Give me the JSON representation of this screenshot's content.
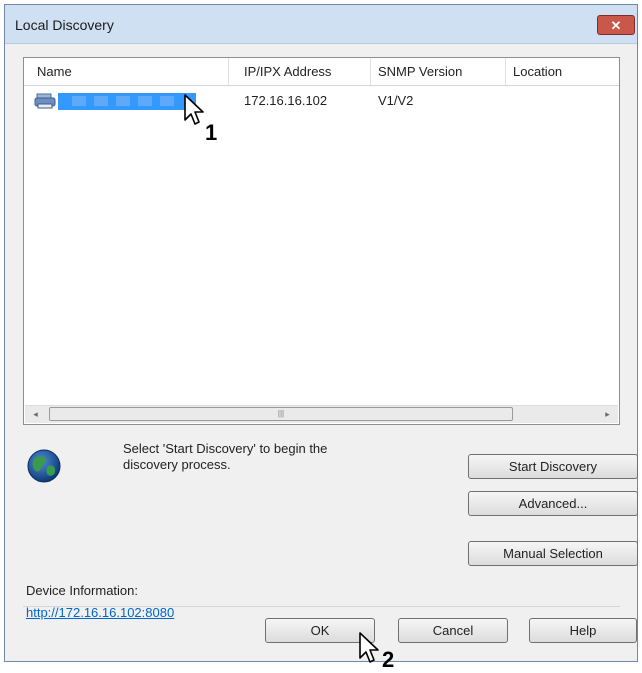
{
  "window": {
    "title": "Local Discovery",
    "close_label": "✕"
  },
  "list": {
    "columns": [
      "Name",
      "IP/IPX Address",
      "SNMP Version",
      "Location"
    ],
    "rows": [
      {
        "name": "",
        "ip": "172.16.16.102",
        "snmp": "V1/V2",
        "location": ""
      }
    ],
    "scroll_left": "◂",
    "scroll_right": "▸",
    "scroll_grip": "|||"
  },
  "status": {
    "text": "Select 'Start Discovery' to begin the discovery process."
  },
  "buttons": {
    "start_discovery": "Start Discovery",
    "advanced": "Advanced...",
    "manual_selection": "Manual Selection",
    "ok": "OK",
    "cancel": "Cancel",
    "help": "Help"
  },
  "device_info": {
    "label": "Device Information:",
    "link": "http://172.16.16.102:8080"
  },
  "annotations": {
    "step1": "1",
    "step2": "2"
  },
  "icons": {
    "printer": "printer-icon",
    "globe": "globe-icon",
    "close": "close-icon",
    "cursor": "cursor-arrow-icon"
  }
}
